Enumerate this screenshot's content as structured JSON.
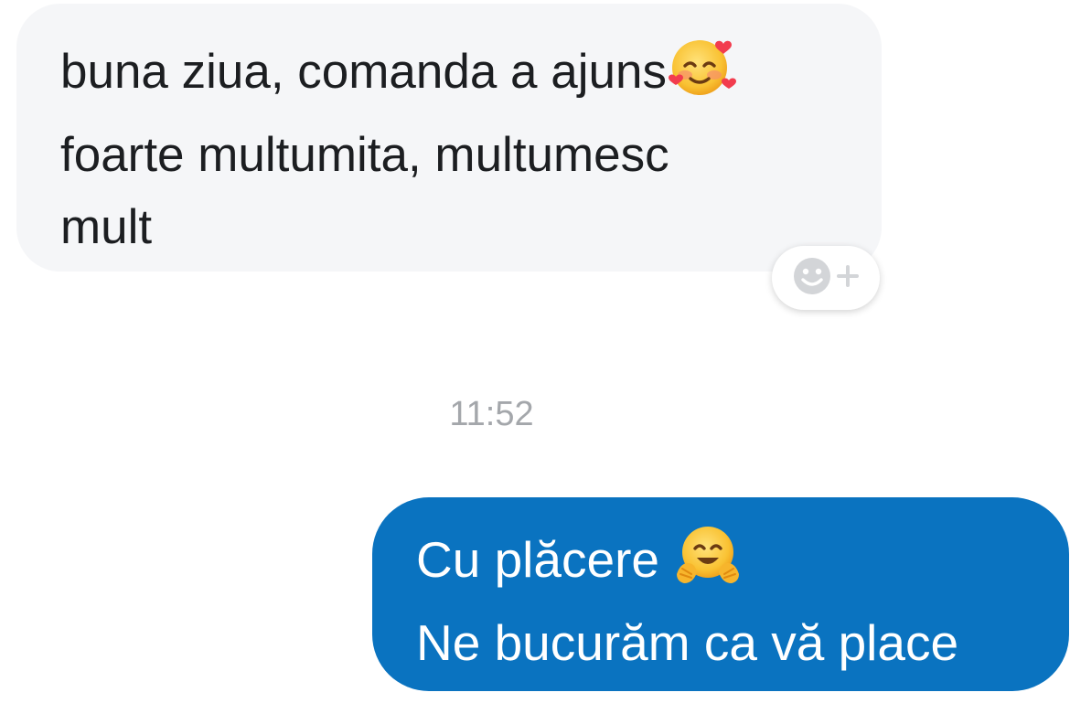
{
  "conversation": {
    "incoming": {
      "lines": [
        "buna ziua, comanda a ajuns",
        "foarte multumita, multumesc",
        "mult"
      ],
      "emoji_icon": "smiling-face-with-hearts"
    },
    "reaction_button": {
      "icon": "add-reaction",
      "plus": "+"
    },
    "timestamp": "11:52",
    "outgoing": {
      "lines": [
        "Cu plăcere ",
        "Ne bucurăm ca vă place"
      ],
      "emoji_icon": "hugging-face",
      "bubble_color": "#0a73c0"
    }
  }
}
